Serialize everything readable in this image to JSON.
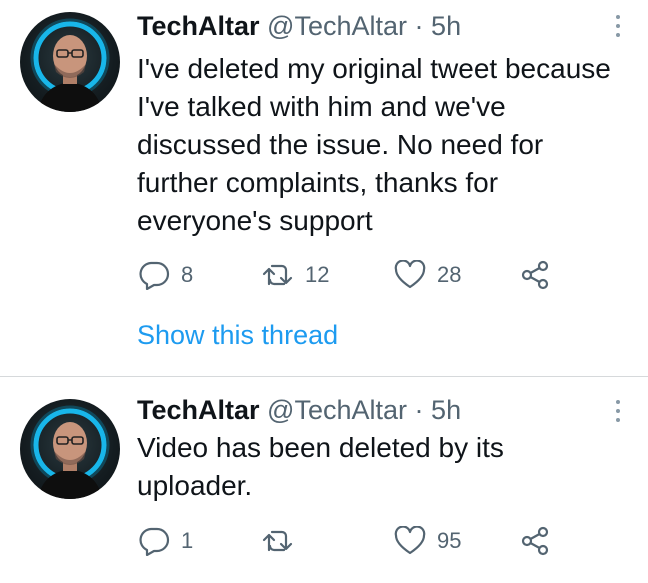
{
  "tweets": [
    {
      "author_name": "TechAltar",
      "author_handle": "@TechAltar",
      "separator": "·",
      "time": "5h",
      "text": "I've deleted my original tweet because I've talked with him and we've discussed the issue. No need for further complaints, thanks for everyone's support",
      "replies": "8",
      "retweets": "12",
      "likes": "28",
      "thread_link": "Show this thread"
    },
    {
      "author_name": "TechAltar",
      "author_handle": "@TechAltar",
      "separator": "·",
      "time": "5h",
      "text": "Video has been deleted by its uploader.",
      "replies": "1",
      "retweets": "",
      "likes": "95"
    }
  ],
  "icons": {
    "reply": "reply-icon",
    "retweet": "retweet-icon",
    "like": "heart-icon",
    "share": "share-icon",
    "more": "more-options-icon"
  },
  "colors": {
    "text": "#0f1419",
    "secondary": "#536471",
    "link": "#1d9bf0",
    "divider": "#d6d9db",
    "avatar_ring": "#18c6ff"
  }
}
